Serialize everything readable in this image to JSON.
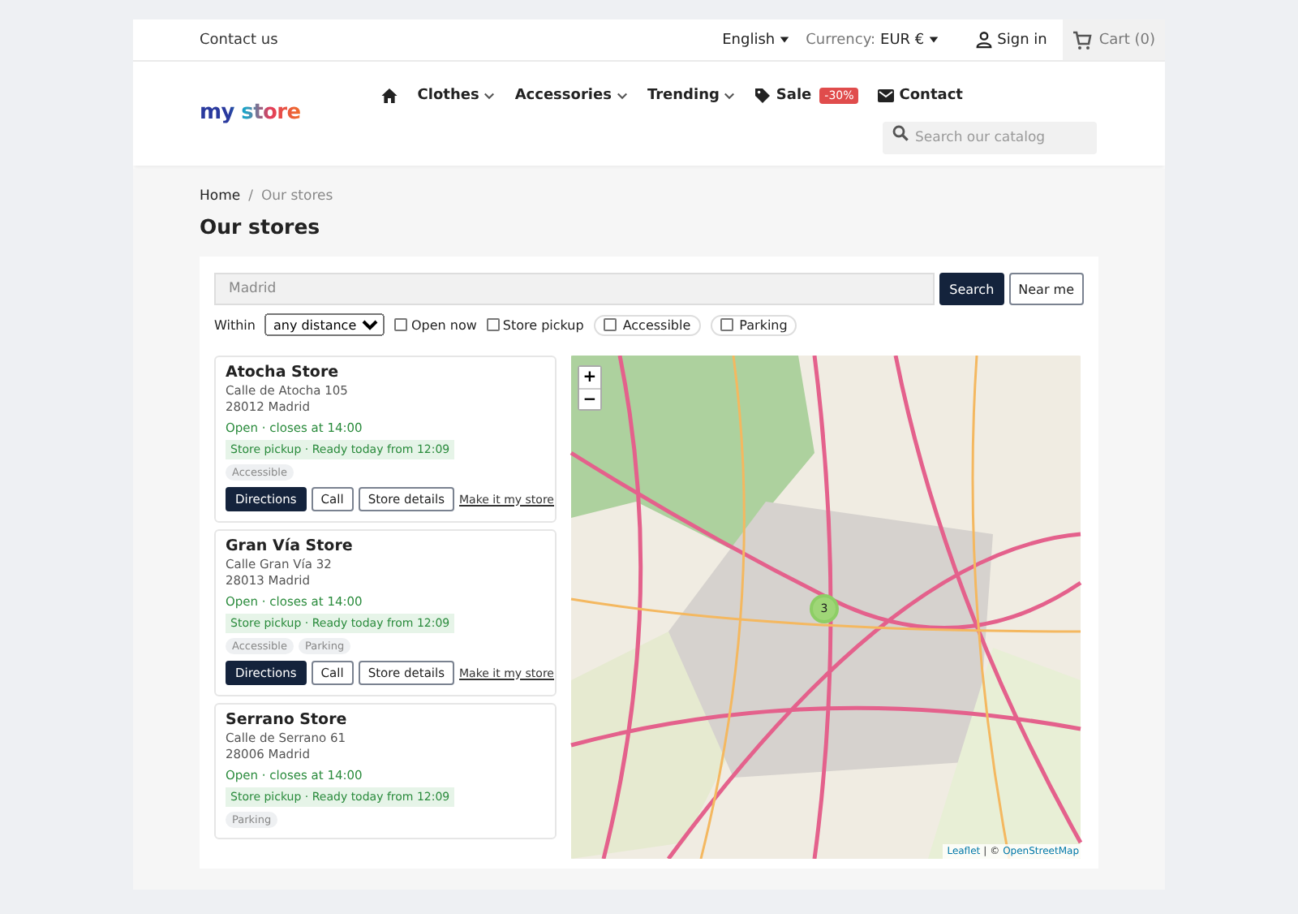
{
  "top_bar": {
    "contact": "Contact us",
    "language": "English",
    "currency_label": "Currency:",
    "currency": "EUR €",
    "sign_in": "Sign in",
    "cart": "Cart (0)"
  },
  "logo": "my store",
  "nav": [
    {
      "kind": "home"
    },
    {
      "kind": "menu",
      "label": "Clothes"
    },
    {
      "kind": "menu",
      "label": "Accessories"
    },
    {
      "kind": "menu",
      "label": "Trending"
    },
    {
      "kind": "sale",
      "label": "Sale",
      "badge": "-30%"
    },
    {
      "kind": "contact",
      "label": "Contact"
    }
  ],
  "search": {
    "placeholder": "Search our catalog"
  },
  "breadcrumb": [
    {
      "label": "Home",
      "current": false
    },
    {
      "label": "Our stores",
      "current": true
    }
  ],
  "breadcrumb_separator": "/",
  "title": "Our stores",
  "locator": {
    "placeholder": "Madrid",
    "search_button": "Search",
    "near_button": "Near me",
    "within_label": "Within",
    "distance": "any distance",
    "filters": [
      {
        "kind": "checkbox",
        "label": "Open now",
        "checked": false
      },
      {
        "kind": "checkbox",
        "label": "Store pickup",
        "checked": false
      },
      {
        "kind": "pill",
        "label": "Accessible",
        "checked": false
      },
      {
        "kind": "pill",
        "label": "Parking",
        "checked": false
      }
    ]
  },
  "stores": [
    {
      "name": "Atocha Store",
      "address": [
        "Calle de Atocha 105",
        "28012 Madrid"
      ],
      "status": "Open · closes at 14:00",
      "pickup": "Store pickup · Ready today from 12:09",
      "tags": [
        "Accessible"
      ],
      "actions": [
        {
          "kind": "primary",
          "label": "Directions"
        },
        {
          "kind": "outline",
          "label": "Call"
        },
        {
          "kind": "outline",
          "label": "Store details"
        },
        {
          "kind": "link",
          "label": "Make it my store"
        }
      ]
    },
    {
      "name": "Gran Vía Store",
      "address": [
        "Calle Gran Vía 32",
        "28013 Madrid"
      ],
      "status": "Open · closes at 14:00",
      "pickup": "Store pickup · Ready today from 12:09",
      "tags": [
        "Accessible",
        "Parking"
      ],
      "actions": [
        {
          "kind": "primary",
          "label": "Directions"
        },
        {
          "kind": "outline",
          "label": "Call"
        },
        {
          "kind": "outline",
          "label": "Store details"
        },
        {
          "kind": "link",
          "label": "Make it my store"
        }
      ]
    },
    {
      "name": "Serrano Store",
      "address": [
        "Calle de Serrano 61",
        "28006 Madrid"
      ],
      "status": "Open · closes at 14:00",
      "pickup": "Store pickup · Ready today from 12:09",
      "tags": [
        "Parking"
      ]
    }
  ],
  "map": {
    "zoom_in": "+",
    "zoom_out": "−",
    "cluster": "3",
    "attribution": {
      "leaflet": "Leaflet",
      "separator": "| ©",
      "osm": "OpenStreetMap"
    }
  }
}
